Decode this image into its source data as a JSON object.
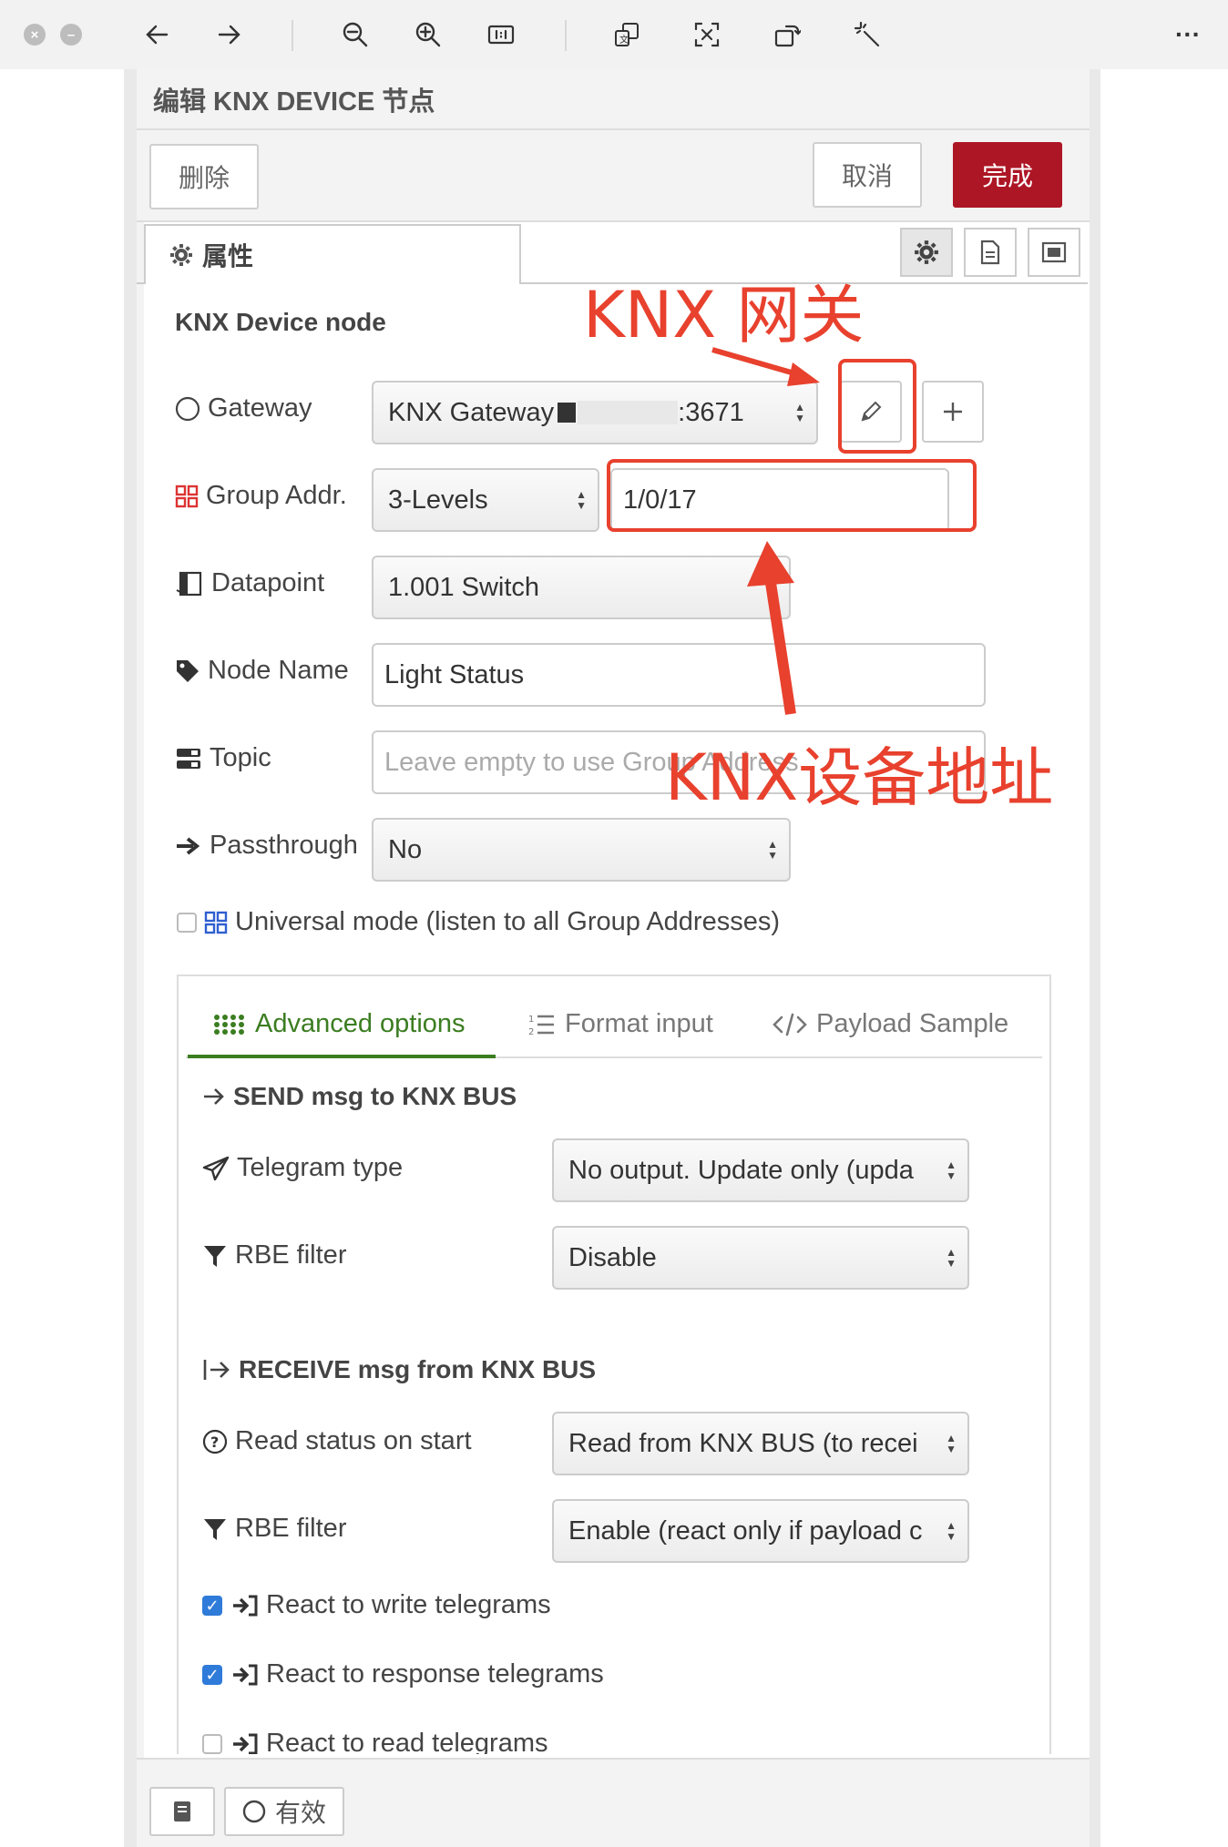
{
  "viewer": {
    "toolbar_icons": [
      "close-circle-icon",
      "minimize-circle-icon",
      "back-arrow-icon",
      "forward-arrow-icon",
      "zoom-out-icon",
      "zoom-in-icon",
      "actual-size-icon",
      "translate-icon",
      "ocr-icon",
      "rotate-icon",
      "magic-wand-icon",
      "more-icon"
    ]
  },
  "tray": {
    "title": "编辑 KNX DEVICE 节点",
    "delete_label": "删除",
    "cancel_label": "取消",
    "done_label": "完成",
    "properties_tab": "属性"
  },
  "node": {
    "section_title": "KNX Device node",
    "gateway_label": "Gateway",
    "gateway_value": "KNX Gateway",
    "gateway_port": ":3671",
    "group_addr_label": "Group Addr.",
    "group_levels": "3-Levels",
    "group_addr_value": "1/0/17",
    "datapoint_label": "Datapoint",
    "datapoint_value": "1.001 Switch",
    "node_name_label": "Node Name",
    "node_name_value": "Light Status",
    "topic_label": "Topic",
    "topic_placeholder": "Leave empty to use Group Address",
    "passthrough_label": "Passthrough",
    "passthrough_value": "No",
    "universal_mode_label": "Universal mode (listen to all Group Addresses)"
  },
  "advanced": {
    "tabs": [
      "Advanced options",
      "Format input",
      "Payload Sample"
    ],
    "send_title": "SEND msg to KNX BUS",
    "telegram_type_label": "Telegram type",
    "telegram_type_value": "No output. Update only (upda",
    "send_rbe_label": "RBE filter",
    "send_rbe_value": "Disable",
    "receive_title": "RECEIVE msg from KNX BUS",
    "read_status_label": "Read status on start",
    "read_status_value": "Read from KNX BUS (to recei",
    "receive_rbe_label": "RBE filter",
    "receive_rbe_value": "Enable (react only if payload c",
    "react_write_label": "React to write telegrams",
    "react_write_checked": true,
    "react_response_label": "React to response telegrams",
    "react_response_checked": true,
    "react_read_label": "React to read telegrams",
    "react_read_checked": false
  },
  "footer": {
    "enabled_label": "有效"
  },
  "annotations": {
    "gateway_note": "KNX 网关",
    "device_address_note": "KNX设备地址",
    "color": "#e8412e"
  }
}
